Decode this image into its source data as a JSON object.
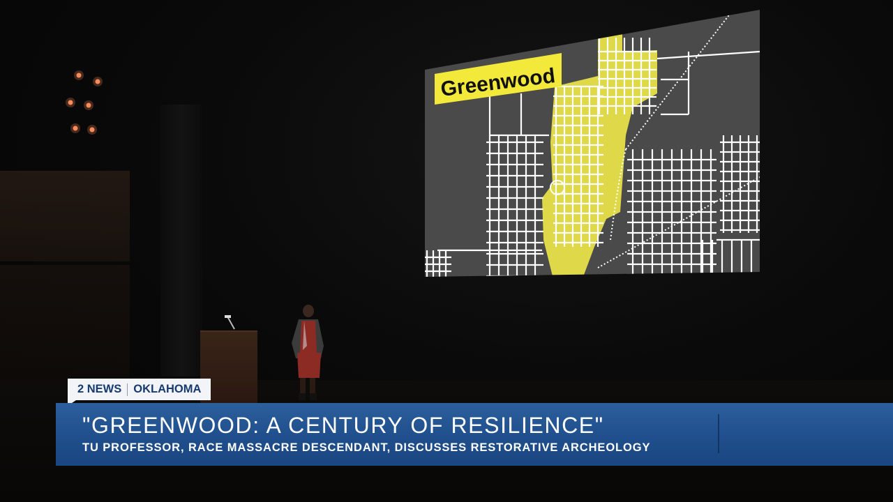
{
  "screen": {
    "label": "Greenwood",
    "colors": {
      "map_bg": "#4a4a4a",
      "streets": "#ffffff",
      "district": "#e7e04a",
      "label_bg": "#f3e93a"
    }
  },
  "bug": {
    "brand": "2 NEWS",
    "region": "OKLAHOMA"
  },
  "lower_third": {
    "headline": "\"GREENWOOD: A CENTURY OF RESILIENCE\"",
    "subheadline": "TU PROFESSOR, RACE MASSACRE DESCENDANT, DISCUSSES RESTORATIVE ARCHEOLOGY",
    "colors": {
      "bar": "#24548f",
      "bug_text": "#173a70"
    }
  }
}
